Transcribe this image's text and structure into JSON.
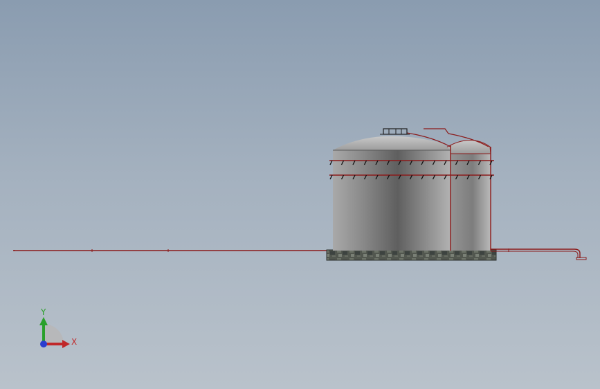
{
  "viewport": {
    "background_top": "#8a9cb0",
    "background_bottom": "#b9c2cb"
  },
  "model": {
    "tank_color": "#8f8f8f",
    "pipe_color": "#8b1a1a",
    "foundation_color": "#4a4f4c"
  },
  "triad": {
    "x_label": "X",
    "y_label": "Y",
    "x_color": "#c0282a",
    "y_color": "#2aa02a",
    "z_color": "#2a3ed0"
  }
}
